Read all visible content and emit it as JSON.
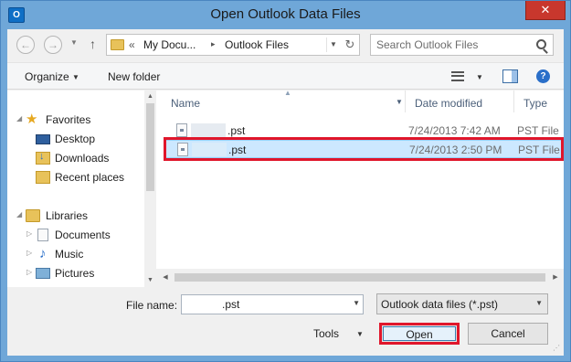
{
  "window": {
    "title": "Open Outlook Data Files",
    "app_icon": "O",
    "close_label": "✕"
  },
  "address": {
    "prefix": "«",
    "crumbs": [
      "My Docu...",
      "Outlook Files"
    ],
    "separator": "▸",
    "refresh": "↻"
  },
  "search": {
    "placeholder": "Search Outlook Files"
  },
  "toolbar": {
    "organize": "Organize",
    "new_folder": "New folder",
    "help": "?"
  },
  "nav": {
    "favorites": "Favorites",
    "desktop": "Desktop",
    "downloads": "Downloads",
    "recent": "Recent places",
    "libraries": "Libraries",
    "documents": "Documents",
    "music": "Music",
    "pictures": "Pictures"
  },
  "columns": {
    "name": "Name",
    "date": "Date modified",
    "type": "Type"
  },
  "files": [
    {
      "name": ".pst",
      "date": "7/24/2013 7:42 AM",
      "type": "PST File",
      "selected": false
    },
    {
      "name": ".pst",
      "date": "7/24/2013 2:50 PM",
      "type": "PST File",
      "selected": true
    }
  ],
  "bottom": {
    "file_name_label": "File name:",
    "file_name_value": ".pst",
    "filter": "Outlook data files (*.pst)",
    "tools": "Tools",
    "open": "Open",
    "cancel": "Cancel"
  },
  "colors": {
    "highlight": "#e0162b",
    "selection": "#cce8ff",
    "title_bar": "#6fa7d8"
  }
}
